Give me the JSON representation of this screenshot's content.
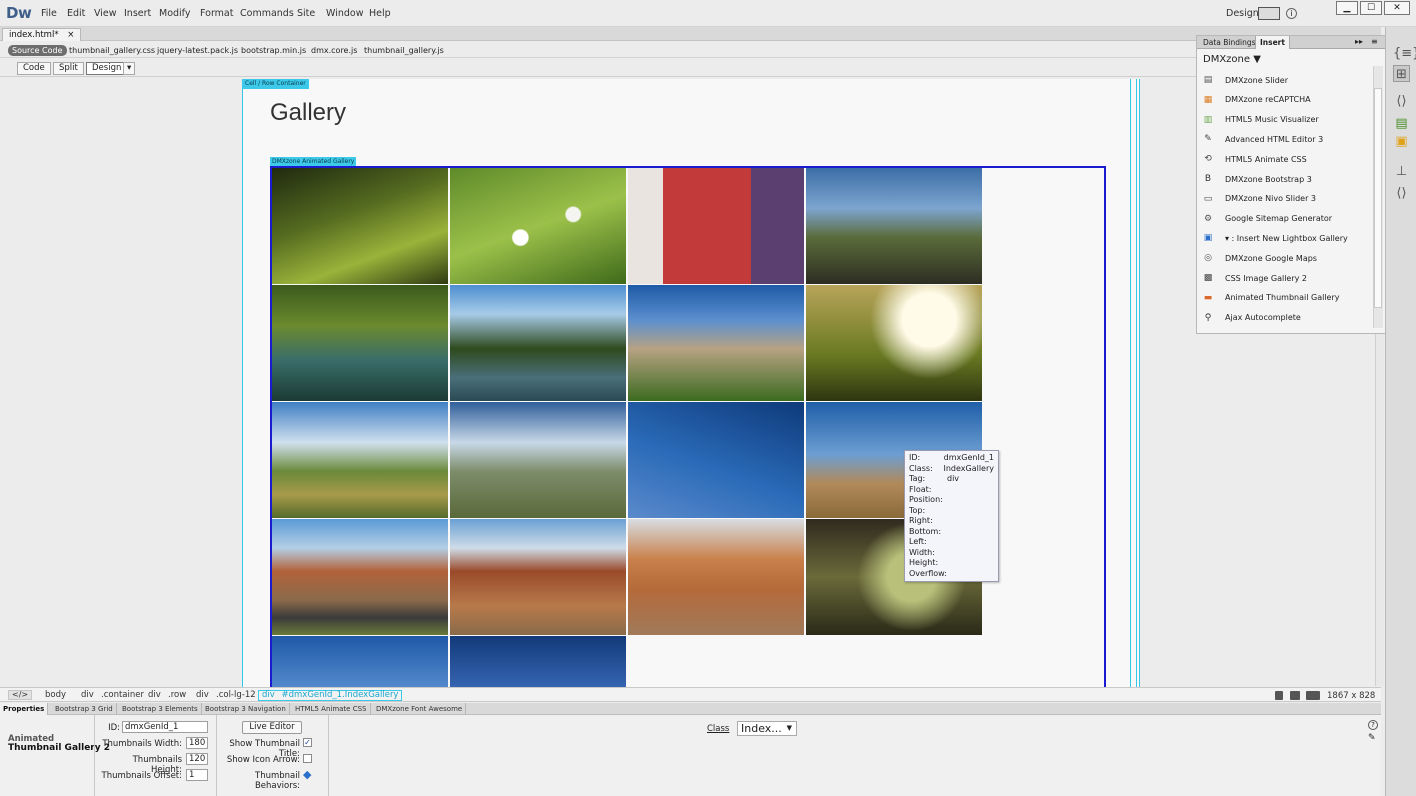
{
  "app": {
    "logo": "Dw"
  },
  "menu": [
    "File",
    "Edit",
    "View",
    "Insert",
    "Modify",
    "Format",
    "Commands",
    "Site",
    "Window",
    "Help"
  ],
  "workspace": {
    "label": "Design ▾"
  },
  "window_controls": {
    "minimize": "▁",
    "maximize": "☐",
    "close": "✕",
    "help": "i"
  },
  "document_tab": {
    "label": "index.html*",
    "close": "×"
  },
  "related_files": {
    "source_code": "Source Code",
    "files": [
      "thumbnail_gallery.css",
      "jquery-latest.pack.js",
      "bootstrap.min.js",
      "dmx.core.js",
      "thumbnail_gallery.js"
    ]
  },
  "view_buttons": {
    "code": "Code",
    "split": "Split",
    "design": "Design",
    "dropdown": "▾"
  },
  "canvas": {
    "row_tag": "Cell / Row Container",
    "heading": "Gallery",
    "gallery_tag": "DMXzone Animated Gallery"
  },
  "tooltip": {
    "rows": [
      {
        "key": "ID:",
        "value": "dmxGenId_1"
      },
      {
        "key": "Class:",
        "value": "IndexGallery"
      },
      {
        "key": "Tag:",
        "value": "div"
      },
      {
        "key": "Float:",
        "value": ""
      },
      {
        "key": "Position:",
        "value": ""
      },
      {
        "key": "Top:",
        "value": ""
      },
      {
        "key": "Right:",
        "value": ""
      },
      {
        "key": "Bottom:",
        "value": ""
      },
      {
        "key": "Left:",
        "value": ""
      },
      {
        "key": "Width:",
        "value": ""
      },
      {
        "key": "Height:",
        "value": ""
      },
      {
        "key": "Overflow:",
        "value": ""
      }
    ]
  },
  "tag_selector": {
    "code_icon": "</>",
    "items": [
      "body",
      "div",
      ".container",
      "div",
      ".row",
      "div",
      ".col-lg-12"
    ],
    "active_tag": "div",
    "active_label": "#dmxGenId_1.IndexGallery",
    "window_size": "1867 x 828 ▾"
  },
  "properties": {
    "tabs": [
      "Properties",
      "Bootstrap 3 Grid",
      "Bootstrap 3 Elements",
      "Bootstrap 3 Navigation",
      "HTML5 Animate CSS",
      "DMXzone Font Awesome"
    ],
    "title_line1": "Animated",
    "title_line2": "Thumbnail Gallery 2",
    "id_label": "ID:",
    "id_value": "dmxGenId_1",
    "thumb_width_label": "Thumbnails Width:",
    "thumb_width_value": "180",
    "thumb_height_label": "Thumbnails Height:",
    "thumb_height_value": "120",
    "thumb_offset_label": "Thumbnails Offset:",
    "thumb_offset_value": "1",
    "live_editor": "Live Editor",
    "show_title_label": "Show Thumbnail Title:",
    "show_title_checked": true,
    "show_arrow_label": "Show Icon Arrow:",
    "show_arrow_checked": false,
    "behaviors_label": "Thumbnail Behaviors:",
    "class_label": "Class",
    "class_value": "Index...",
    "help": "?"
  },
  "insert_panel": {
    "tabs": [
      "Data Bindings",
      "Insert"
    ],
    "category": "DMXzone ▼",
    "items": [
      {
        "label": "DMXzone Slider",
        "icon": "slider-icon",
        "glyph": "▤",
        "color": "#555"
      },
      {
        "label": "DMXzone reCAPTCHA",
        "icon": "recaptcha-icon",
        "glyph": "▦",
        "color": "#d97b1f"
      },
      {
        "label": "HTML5 Music Visualizer",
        "icon": "music-visualizer-icon",
        "glyph": "▥",
        "color": "#6aa84f"
      },
      {
        "label": "Advanced HTML Editor 3",
        "icon": "html-editor-icon",
        "glyph": "✎",
        "color": "#444"
      },
      {
        "label": "HTML5 Animate CSS",
        "icon": "animate-css-icon",
        "glyph": "⟲",
        "color": "#444"
      },
      {
        "label": "DMXzone Bootstrap 3",
        "icon": "bootstrap-icon",
        "glyph": "B",
        "color": "#333"
      },
      {
        "label": "DMXzone Nivo Slider 3",
        "icon": "nivo-slider-icon",
        "glyph": "▭",
        "color": "#444"
      },
      {
        "label": "Google Sitemap Generator",
        "icon": "sitemap-icon",
        "glyph": "⚙",
        "color": "#555"
      },
      {
        "label": "▾ : Insert New Lightbox Gallery",
        "icon": "lightbox-icon",
        "glyph": "▣",
        "color": "#2a6fc9"
      },
      {
        "label": "DMXzone Google Maps",
        "icon": "google-maps-icon",
        "glyph": "◎",
        "color": "#555"
      },
      {
        "label": "CSS Image Gallery 2",
        "icon": "image-gallery-icon",
        "glyph": "▩",
        "color": "#444"
      },
      {
        "label": "Animated Thumbnail Gallery",
        "icon": "thumbnail-gallery-icon",
        "glyph": "▬",
        "color": "#d9682a"
      },
      {
        "label": "Ajax Autocomplete",
        "icon": "search-icon",
        "glyph": "⚲",
        "color": "#333"
      }
    ]
  },
  "theme": {
    "guide_color": "#34c8e8",
    "selection_color": "#1a1ad0",
    "tag_color": "#3cc9ea"
  }
}
